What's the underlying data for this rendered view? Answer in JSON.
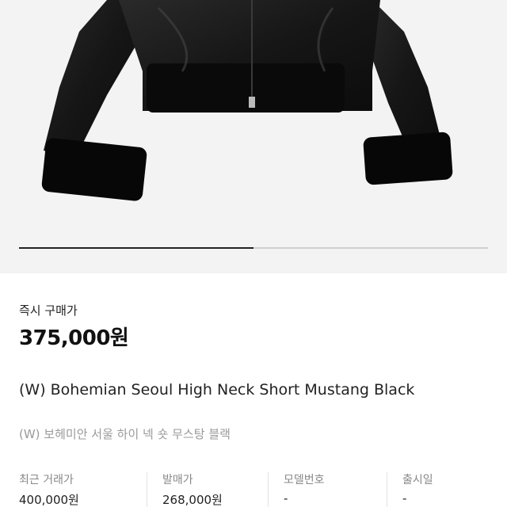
{
  "carousel": {
    "progress_fraction": 0.5
  },
  "purchase": {
    "label": "즉시 구매가",
    "price": "375,000원"
  },
  "product": {
    "name_en": "(W) Bohemian Seoul High Neck Short Mustang Black",
    "name_ko": "(W) 보헤미안 서울 하이 넥 숏 무스탕 블랙"
  },
  "info": [
    {
      "label": "최근 거래가",
      "value": "400,000원"
    },
    {
      "label": "발매가",
      "value": "268,000원"
    },
    {
      "label": "모델번호",
      "value": "-"
    },
    {
      "label": "출시일",
      "value": "-"
    }
  ]
}
